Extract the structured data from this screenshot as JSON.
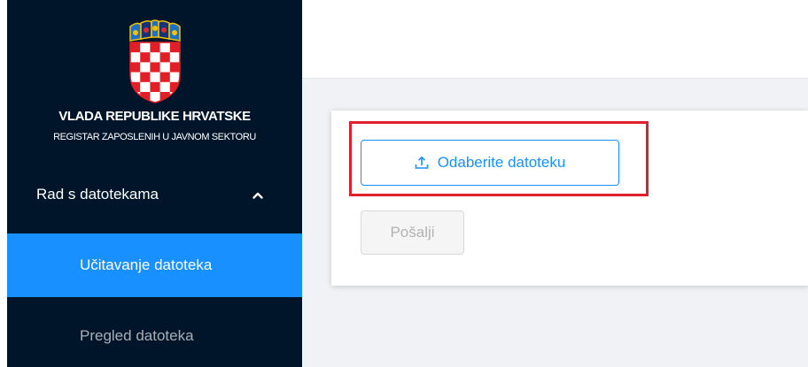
{
  "sidebar": {
    "coat_of_arms": "croatian-coat-of-arms-icon",
    "title": "VLADA REPUBLIKE HRVATSKE",
    "subtitle": "REGISTAR ZAPOSLENIH U JAVNOM SEKTORU",
    "submenu": {
      "label": "Rad s datotekama",
      "expanded": true,
      "icon": "chevron-up-icon",
      "items": [
        {
          "label": "Učitavanje datoteka",
          "active": true
        },
        {
          "label": "Pregled datoteka",
          "active": false
        }
      ]
    }
  },
  "main": {
    "upload_button": {
      "label": "Odaberite datoteku",
      "icon": "upload-icon"
    },
    "send_button": {
      "label": "Pošalji",
      "disabled": true
    },
    "highlight_color": "#e0202e"
  },
  "colors": {
    "sidebar_bg": "#001529",
    "active_item_bg": "#1890ff",
    "primary": "#1890ff",
    "content_bg": "#f0f2f5"
  }
}
